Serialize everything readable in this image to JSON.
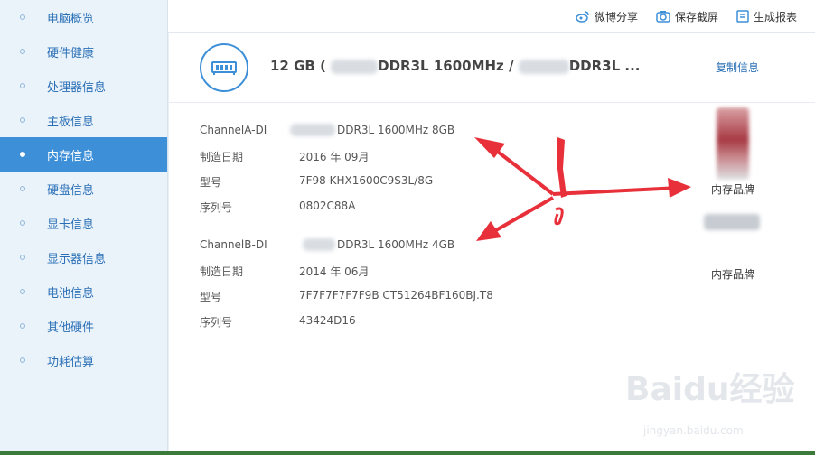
{
  "sidebar": {
    "items": [
      {
        "label": "电脑概览"
      },
      {
        "label": "硬件健康"
      },
      {
        "label": "处理器信息"
      },
      {
        "label": "主板信息"
      },
      {
        "label": "内存信息"
      },
      {
        "label": "硬盘信息"
      },
      {
        "label": "显卡信息"
      },
      {
        "label": "显示器信息"
      },
      {
        "label": "电池信息"
      },
      {
        "label": "其他硬件"
      },
      {
        "label": "功耗估算"
      }
    ],
    "active_index": 4
  },
  "topbar": {
    "weibo_label": "微博分享",
    "screenshot_label": "保存截屏",
    "report_label": "生成报表"
  },
  "header": {
    "summary_prefix": "12 GB (",
    "summary_mid": "DDR3L 1600MHz /",
    "summary_tail": "DDR3L ...",
    "copy_label": "复制信息"
  },
  "channels": [
    {
      "title_prefix": "ChannelA-DI",
      "title_value": "DDR3L 1600MHz 8GB",
      "date_label": "制造日期",
      "date_value": "2016 年 09月",
      "model_label": "型号",
      "model_value": "7F98 KHX1600C9S3L/8G",
      "serial_label": "序列号",
      "serial_value": "0802C88A",
      "brand_label": "内存品牌"
    },
    {
      "title_prefix": "ChannelB-DI",
      "title_value": "DDR3L 1600MHz 4GB",
      "date_label": "制造日期",
      "date_value": "2014 年 06月",
      "model_label": "型号",
      "model_value": "7F7F7F7F7F9B CT51264BF160BJ.T8",
      "serial_label": "序列号",
      "serial_value": "43424D16",
      "brand_label": "内存品牌"
    }
  ],
  "watermark": {
    "text": "Baidu经验",
    "sub": "jingyan.baidu.com"
  },
  "colors": {
    "accent": "#3d8fd8",
    "annotation": "#e8303a"
  }
}
